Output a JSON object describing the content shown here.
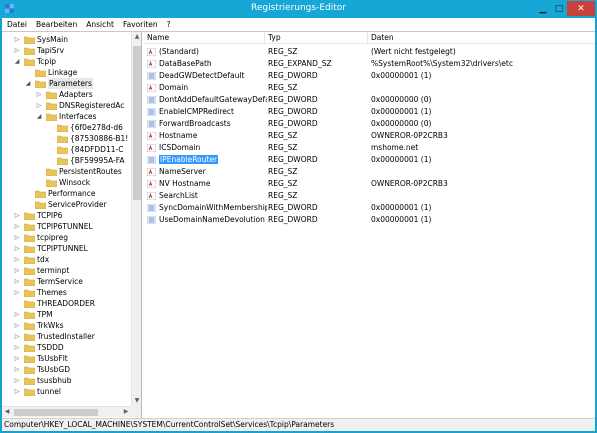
{
  "window": {
    "title": "Registrierungs-Editor",
    "controls": {
      "minimize": "▁",
      "maximize": "□",
      "close": "✕"
    },
    "colors": {
      "titlebar": "#16a7d6",
      "close": "#c7433a",
      "selection": "#3399ff",
      "folder": "#e8c45a"
    }
  },
  "menu": [
    "Datei",
    "Bearbeiten",
    "Ansicht",
    "Favoriten",
    "?"
  ],
  "tree": [
    {
      "label": "SysMain",
      "level": 0,
      "expander": "▷"
    },
    {
      "label": "TapiSrv",
      "level": 0,
      "expander": "▷"
    },
    {
      "label": "Tcpip",
      "level": 0,
      "expander": "◢"
    },
    {
      "label": "Linkage",
      "level": 1,
      "expander": ""
    },
    {
      "label": "Parameters",
      "level": 1,
      "expander": "◢",
      "selected": true
    },
    {
      "label": "Adapters",
      "level": 2,
      "expander": "▷"
    },
    {
      "label": "DNSRegisteredAc",
      "level": 2,
      "expander": "▷"
    },
    {
      "label": "Interfaces",
      "level": 2,
      "expander": "◢"
    },
    {
      "label": "{6f0e278d-d6",
      "level": 3,
      "expander": ""
    },
    {
      "label": "{87530886-B1!",
      "level": 3,
      "expander": ""
    },
    {
      "label": "{84DFDD11-C",
      "level": 3,
      "expander": ""
    },
    {
      "label": "{BF59995A-FA",
      "level": 3,
      "expander": ""
    },
    {
      "label": "PersistentRoutes",
      "level": 2,
      "expander": ""
    },
    {
      "label": "Winsock",
      "level": 2,
      "expander": ""
    },
    {
      "label": "Performance",
      "level": 1,
      "expander": ""
    },
    {
      "label": "ServiceProvider",
      "level": 1,
      "expander": ""
    },
    {
      "label": "TCPIP6",
      "level": 0,
      "expander": "▷"
    },
    {
      "label": "TCPIP6TUNNEL",
      "level": 0,
      "expander": "▷"
    },
    {
      "label": "tcpipreg",
      "level": 0,
      "expander": "▷"
    },
    {
      "label": "TCPIPTUNNEL",
      "level": 0,
      "expander": "▷"
    },
    {
      "label": "tdx",
      "level": 0,
      "expander": "▷"
    },
    {
      "label": "terminpt",
      "level": 0,
      "expander": "▷"
    },
    {
      "label": "TermService",
      "level": 0,
      "expander": "▷"
    },
    {
      "label": "Themes",
      "level": 0,
      "expander": "▷"
    },
    {
      "label": "THREADORDER",
      "level": 0,
      "expander": ""
    },
    {
      "label": "TPM",
      "level": 0,
      "expander": "▷"
    },
    {
      "label": "TrkWks",
      "level": 0,
      "expander": "▷"
    },
    {
      "label": "TrustedInstaller",
      "level": 0,
      "expander": "▷"
    },
    {
      "label": "TSDDD",
      "level": 0,
      "expander": "▷"
    },
    {
      "label": "TsUsbFlt",
      "level": 0,
      "expander": "▷"
    },
    {
      "label": "TsUsbGD",
      "level": 0,
      "expander": "▷"
    },
    {
      "label": "tsusbhub",
      "level": 0,
      "expander": "▷"
    },
    {
      "label": "tunnel",
      "level": 0,
      "expander": "▷"
    }
  ],
  "columns": {
    "name": "Name",
    "type": "Typ",
    "data": "Daten"
  },
  "values": [
    {
      "name": "(Standard)",
      "type": "REG_SZ",
      "data": "(Wert nicht festgelegt)",
      "icon": "string-value-icon"
    },
    {
      "name": "DataBasePath",
      "type": "REG_EXPAND_SZ",
      "data": "%SystemRoot%\\System32\\drivers\\etc",
      "icon": "string-value-icon"
    },
    {
      "name": "DeadGWDetectDefault",
      "type": "REG_DWORD",
      "data": "0x00000001 (1)",
      "icon": "binary-value-icon"
    },
    {
      "name": "Domain",
      "type": "REG_SZ",
      "data": "",
      "icon": "string-value-icon"
    },
    {
      "name": "DontAddDefaultGatewayDefault",
      "type": "REG_DWORD",
      "data": "0x00000000 (0)",
      "icon": "binary-value-icon"
    },
    {
      "name": "EnableICMPRedirect",
      "type": "REG_DWORD",
      "data": "0x00000001 (1)",
      "icon": "binary-value-icon"
    },
    {
      "name": "ForwardBroadcasts",
      "type": "REG_DWORD",
      "data": "0x00000000 (0)",
      "icon": "binary-value-icon"
    },
    {
      "name": "Hostname",
      "type": "REG_SZ",
      "data": "OWNEROR-0P2CRB3",
      "icon": "string-value-icon"
    },
    {
      "name": "ICSDomain",
      "type": "REG_SZ",
      "data": "mshome.net",
      "icon": "string-value-icon"
    },
    {
      "name": "IPEnableRouter",
      "type": "REG_DWORD",
      "data": "0x00000001 (1)",
      "icon": "binary-value-icon",
      "selected": true
    },
    {
      "name": "NameServer",
      "type": "REG_SZ",
      "data": "",
      "icon": "string-value-icon"
    },
    {
      "name": "NV Hostname",
      "type": "REG_SZ",
      "data": "OWNEROR-0P2CRB3",
      "icon": "string-value-icon"
    },
    {
      "name": "SearchList",
      "type": "REG_SZ",
      "data": "",
      "icon": "string-value-icon"
    },
    {
      "name": "SyncDomainWithMembership",
      "type": "REG_DWORD",
      "data": "0x00000001 (1)",
      "icon": "binary-value-icon"
    },
    {
      "name": "UseDomainNameDevolution",
      "type": "REG_DWORD",
      "data": "0x00000001 (1)",
      "icon": "binary-value-icon"
    }
  ],
  "status": {
    "path": "Computer\\HKEY_LOCAL_MACHINE\\SYSTEM\\CurrentControlSet\\Services\\Tcpip\\Parameters"
  },
  "scrollbars": {
    "tree_vertical": {
      "up": "▲",
      "down": "▼"
    },
    "tree_horizontal": {
      "left": "◀",
      "right": "▶"
    }
  }
}
